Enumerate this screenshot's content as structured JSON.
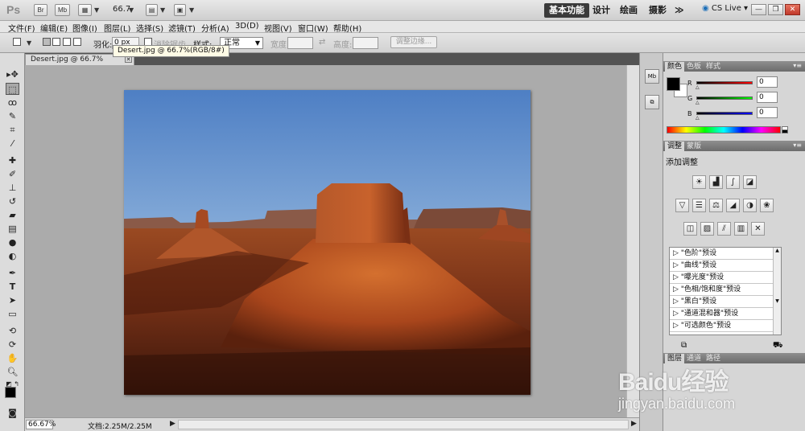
{
  "appbar": {
    "logo": "Ps",
    "btn_br": "Br",
    "btn_mb": "Mb",
    "zoom": "66.7",
    "workspaces": [
      "基本功能",
      "设计",
      "绘画",
      "摄影"
    ],
    "more": "≫",
    "cslive": "CS Live",
    "window_buttons": [
      "—",
      "❐",
      "✕"
    ]
  },
  "menubar": {
    "items": [
      "文件(F)",
      "编辑(E)",
      "图像(I)",
      "图层(L)",
      "选择(S)",
      "滤镜(T)",
      "分析(A)",
      "3D(D)",
      "视图(V)",
      "窗口(W)",
      "帮助(H)"
    ]
  },
  "options": {
    "feather_label": "羽化:",
    "feather_value": "0 px",
    "antialias_label": "消除锯齿",
    "style_label": "样式:",
    "style_value": "正常",
    "width_label": "宽度:",
    "height_label": "高度:",
    "refine_button": "调整边缘..."
  },
  "tooltip": "Desert.jpg @ 66.7%(RGB/8#)",
  "document": {
    "tab_title": "Desert.jpg @ 66.7%(RGB/8#)",
    "close": "✕"
  },
  "status": {
    "zoom": "66.67%",
    "doc": "文档:2.25M/2.25M"
  },
  "toolbox": {
    "tools": [
      "move-icon",
      "marquee-icon",
      "lasso-icon",
      "quick-select-icon",
      "crop-icon",
      "eyedropper-icon",
      "healing-icon",
      "brush-icon",
      "stamp-icon",
      "history-brush-icon",
      "eraser-icon",
      "gradient-icon",
      "blur-icon",
      "dodge-icon",
      "pen-icon",
      "type-icon",
      "path-select-icon",
      "shape-icon",
      "3d-rotate-icon",
      "3d-orbit-icon",
      "hand-icon",
      "zoom-icon"
    ]
  },
  "panels": {
    "color_tabs": [
      "颜色",
      "色板",
      "样式"
    ],
    "color": {
      "r_label": "R",
      "g_label": "G",
      "b_label": "B",
      "r": "0",
      "g": "0",
      "b": "0"
    },
    "adjust_tabs": [
      "调整",
      "蒙版"
    ],
    "adjust_title": "添加调整",
    "presets": [
      "\"色阶\"预设",
      "\"曲线\"预设",
      "\"曝光度\"预设",
      "\"色相/饱和度\"预设",
      "\"黑白\"预设",
      "\"通道混和器\"预设",
      "\"可选颜色\"预设"
    ],
    "layer_tabs": [
      "图层",
      "通道",
      "路径"
    ]
  },
  "watermark": {
    "logo": "Baidu经验",
    "url": "jingyan.baidu.com"
  }
}
